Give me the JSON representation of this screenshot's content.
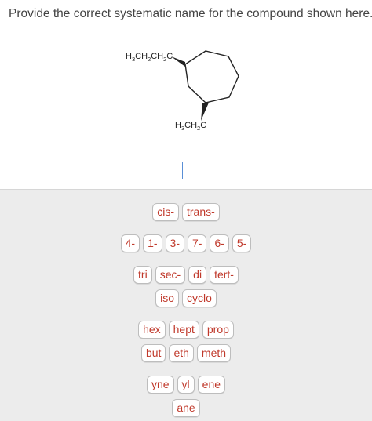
{
  "question": "Provide the correct systematic name for the compound shown here.",
  "structure": {
    "substituent_top": {
      "parts": [
        "H",
        "3",
        "CH",
        "2",
        "CH",
        "2",
        "C"
      ]
    },
    "substituent_bottom": {
      "parts": [
        "H",
        "3",
        "CH",
        "2",
        "C"
      ]
    }
  },
  "palette": {
    "stereo": [
      "cis-",
      "trans-"
    ],
    "locants": [
      "4-",
      "1-",
      "3-",
      "7-",
      "6-",
      "5-"
    ],
    "prefixes": [
      "tri",
      "sec-",
      "di",
      "tert-"
    ],
    "prefixes2": [
      "iso",
      "cyclo"
    ],
    "roots": [
      "hex",
      "hept",
      "prop"
    ],
    "roots2": [
      "but",
      "eth",
      "meth"
    ],
    "suffixes": [
      "yne",
      "yl",
      "ene"
    ],
    "suffixes2": [
      "ane"
    ]
  },
  "colors": {
    "tile_text": "#c0392b",
    "palette_bg": "#ececec",
    "caret": "#5a8fd6"
  }
}
